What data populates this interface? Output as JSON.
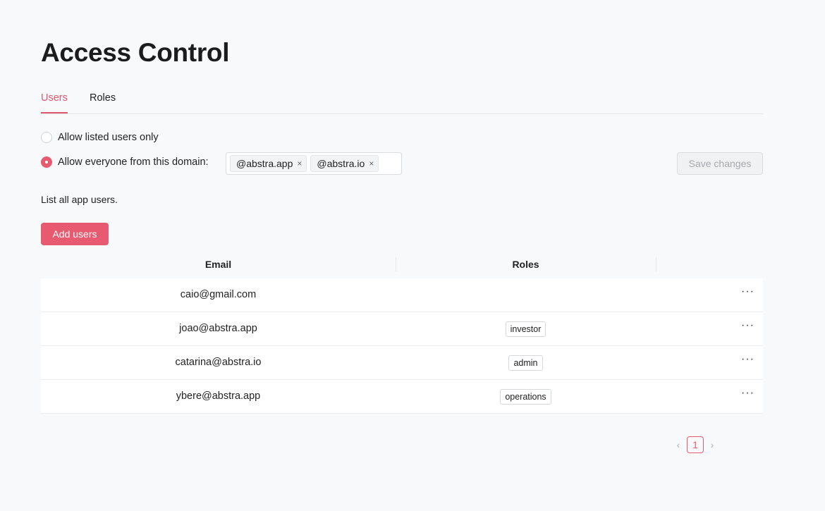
{
  "page": {
    "title": "Access Control"
  },
  "tabs": [
    {
      "label": "Users",
      "active": true
    },
    {
      "label": "Roles",
      "active": false
    }
  ],
  "access": {
    "option_listed": "Allow listed users only",
    "option_domain": "Allow everyone from this domain:",
    "selected": "domain",
    "domains": [
      "@abstra.app",
      "@abstra.io"
    ],
    "remove_glyph": "×",
    "save_label": "Save changes"
  },
  "users": {
    "description": "List all app users.",
    "add_label": "Add users",
    "columns": [
      "Email",
      "Roles"
    ],
    "rows": [
      {
        "email": "caio@gmail.com",
        "role": ""
      },
      {
        "email": "joao@abstra.app",
        "role": "investor"
      },
      {
        "email": "catarina@abstra.io",
        "role": "admin"
      },
      {
        "email": "ybere@abstra.app",
        "role": "operations"
      }
    ],
    "row_menu_glyph": "···"
  },
  "pagination": {
    "prev": "‹",
    "page": "1",
    "next": "›"
  },
  "colors": {
    "accent": "#e85a6f",
    "background": "#f8f9fb"
  }
}
